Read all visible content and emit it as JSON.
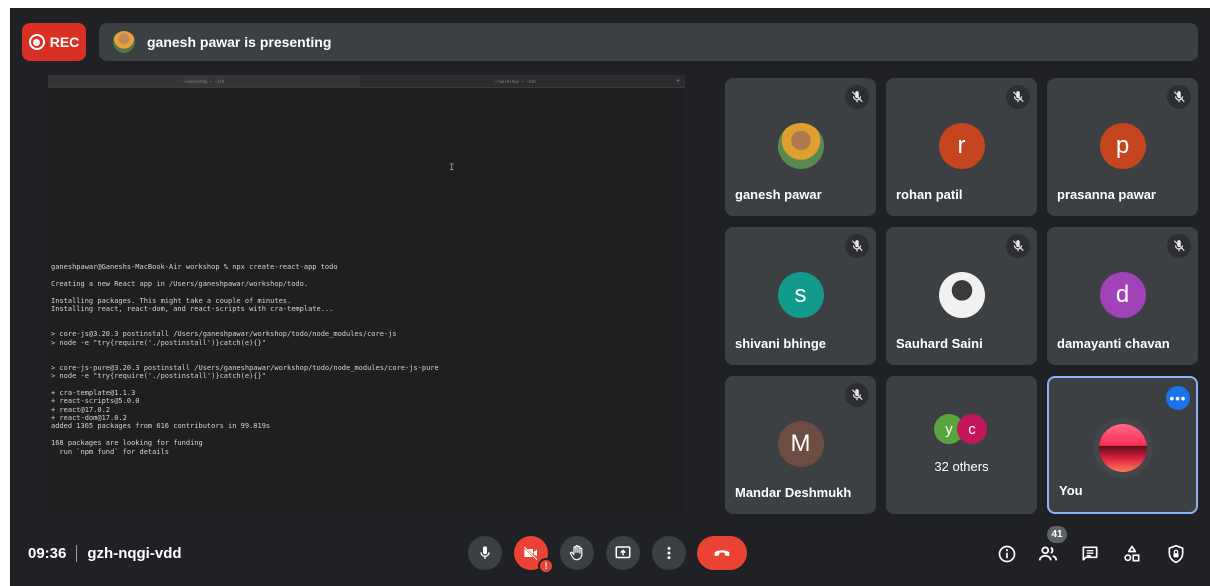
{
  "colors": {
    "background": "#202124",
    "tile": "#3c4043",
    "record": "#d93025",
    "end_call": "#ea4335",
    "accent": "#8ab4f8"
  },
  "top_bar": {
    "rec_label": "REC",
    "presenting_text": "ganesh pawar is presenting"
  },
  "terminal": {
    "tabs": [
      "~/workshop — -zsh",
      "~/workshop — -zsh"
    ],
    "lines": [
      "ganeshpawar@Ganeshs-MacBook-Air workshop % npx create-react-app todo",
      "",
      "Creating a new React app in /Users/ganeshpawar/workshop/todo.",
      "",
      "Installing packages. This might take a couple of minutes.",
      "Installing react, react-dom, and react-scripts with cra-template...",
      "",
      "",
      "> core-js@3.20.3 postinstall /Users/ganeshpawar/workshop/todo/node_modules/core-js",
      "> node -e \"try{require('./postinstall')}catch(e){}\"",
      "",
      "",
      "> core-js-pure@3.20.3 postinstall /Users/ganeshpawar/workshop/todo/node_modules/core-js-pure",
      "> node -e \"try{require('./postinstall')}catch(e){}\"",
      "",
      "+ cra-template@1.1.3",
      "+ react-scripts@5.0.0",
      "+ react@17.0.2",
      "+ react-dom@17.0.2",
      "added 1365 packages from 616 contributors in 99.819s",
      "",
      "168 packages are looking for funding",
      "  run `npm fund` for details"
    ]
  },
  "participants": [
    {
      "name": "ganesh pawar",
      "initial": "",
      "avatar_color": "",
      "muted": true
    },
    {
      "name": "rohan patil",
      "initial": "r",
      "avatar_color": "#c5461e",
      "muted": true
    },
    {
      "name": "prasanna pawar",
      "initial": "p",
      "avatar_color": "#c5461e",
      "muted": true
    },
    {
      "name": "shivani bhinge",
      "initial": "s",
      "avatar_color": "#129b8a",
      "muted": true
    },
    {
      "name": "Sauhard Saini",
      "initial": "",
      "avatar_color": "",
      "muted": true
    },
    {
      "name": "damayanti chavan",
      "initial": "d",
      "avatar_color": "#a142b8",
      "muted": true
    },
    {
      "name": "Mandar Deshmukh",
      "initial": "M",
      "avatar_color": "#6d4c41",
      "muted": true
    }
  ],
  "others": {
    "initials": [
      "y",
      "c"
    ],
    "colors": [
      "#58a53f",
      "#c2185b"
    ],
    "label": "32 others"
  },
  "self_tile": {
    "name": "You"
  },
  "bottom_bar": {
    "time": "09:36",
    "meeting_code": "gzh-nqgi-vdd",
    "participant_count": "41",
    "camera_alert": "!"
  }
}
